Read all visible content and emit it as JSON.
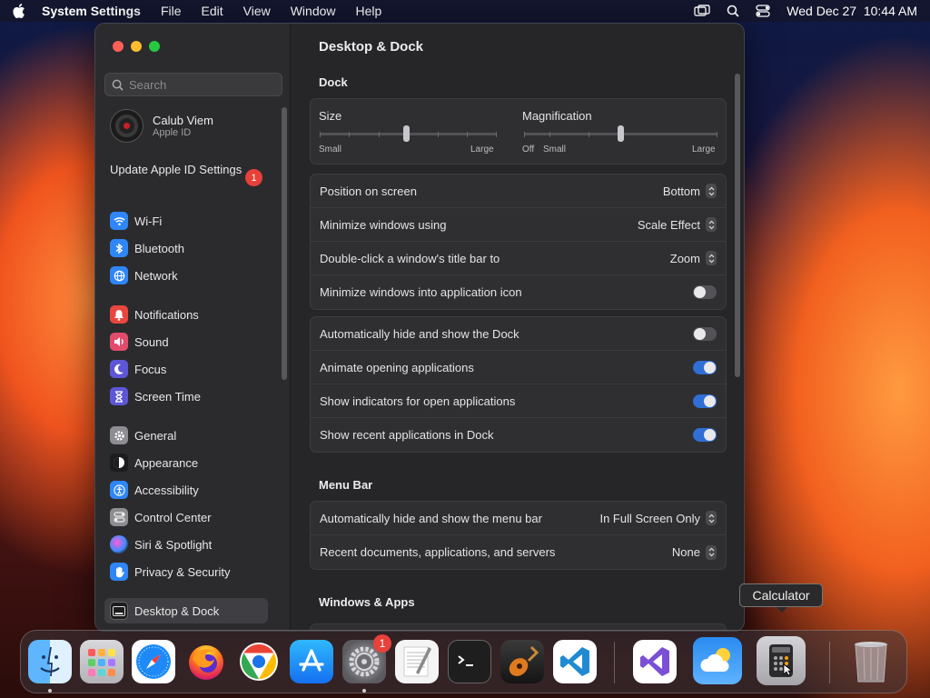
{
  "menubar": {
    "app_name": "System Settings",
    "items": [
      "File",
      "Edit",
      "View",
      "Window",
      "Help"
    ],
    "datetime": "Wed Dec 27  10:44 AM"
  },
  "sidebar": {
    "search_placeholder": "Search",
    "user": {
      "name": "Calub Viem",
      "subtitle": "Apple ID"
    },
    "update_label": "Update Apple ID Settings",
    "update_badge": "1",
    "items": [
      {
        "label": "Wi-Fi",
        "icon": "wifi-icon",
        "color": "#2f86f6"
      },
      {
        "label": "Bluetooth",
        "icon": "bluetooth-icon",
        "color": "#2f86f6"
      },
      {
        "label": "Network",
        "icon": "globe-icon",
        "color": "#2f86f6"
      },
      {
        "label": "Notifications",
        "icon": "bell-icon",
        "color": "#e8463e"
      },
      {
        "label": "Sound",
        "icon": "speaker-icon",
        "color": "#e24c6b"
      },
      {
        "label": "Focus",
        "icon": "moon-icon",
        "color": "#5d56d6"
      },
      {
        "label": "Screen Time",
        "icon": "hourglass-icon",
        "color": "#5d56d6"
      },
      {
        "label": "General",
        "icon": "gear-icon",
        "color": "#8d8d92"
      },
      {
        "label": "Appearance",
        "icon": "appearance-icon",
        "color": "#1c1c1e"
      },
      {
        "label": "Accessibility",
        "icon": "accessibility-icon",
        "color": "#2f86f6"
      },
      {
        "label": "Control Center",
        "icon": "control-center-icon",
        "color": "#8d8d92"
      },
      {
        "label": "Siri & Spotlight",
        "icon": "siri-icon",
        "color": "#6a3fd0"
      },
      {
        "label": "Privacy & Security",
        "icon": "hand-icon",
        "color": "#2f86f6"
      },
      {
        "label": "Desktop & Dock",
        "icon": "dock-icon",
        "color": "#1c1c1e"
      }
    ]
  },
  "content": {
    "title": "Desktop & Dock",
    "dock_section": "Dock",
    "size": {
      "label": "Size",
      "min_label": "Small",
      "max_label": "Large",
      "value": 0.49
    },
    "magnification": {
      "label": "Magnification",
      "off_label": "Off",
      "min_label": "Small",
      "max_label": "Large",
      "value": 0.5
    },
    "position": {
      "label": "Position on screen",
      "value": "Bottom"
    },
    "minimize_using": {
      "label": "Minimize windows using",
      "value": "Scale Effect"
    },
    "double_click": {
      "label": "Double-click a window's title bar to",
      "value": "Zoom"
    },
    "minimize_into_icon": {
      "label": "Minimize windows into application icon",
      "on": false
    },
    "auto_hide_dock": {
      "label": "Automatically hide and show the Dock",
      "on": false
    },
    "animate": {
      "label": "Animate opening applications",
      "on": true
    },
    "indicators": {
      "label": "Show indicators for open applications",
      "on": true
    },
    "recent_apps": {
      "label": "Show recent applications in Dock",
      "on": true
    },
    "menu_bar_section": "Menu Bar",
    "auto_hide_menu": {
      "label": "Automatically hide and show the menu bar",
      "value": "In Full Screen Only"
    },
    "recent_docs": {
      "label": "Recent documents, applications, and servers",
      "value": "None"
    },
    "windows_apps_section": "Windows & Apps"
  },
  "dock": {
    "tooltip": "Calculator",
    "apps": [
      "Finder",
      "Launchpad",
      "Safari",
      "Firefox",
      "Chrome",
      "App Store",
      "System Settings",
      "TextEdit",
      "Terminal",
      "GarageBand",
      "Visual Studio Code",
      "Visual Studio",
      "Weather",
      "Calculator",
      "Trash"
    ],
    "settings_badge": "1"
  }
}
